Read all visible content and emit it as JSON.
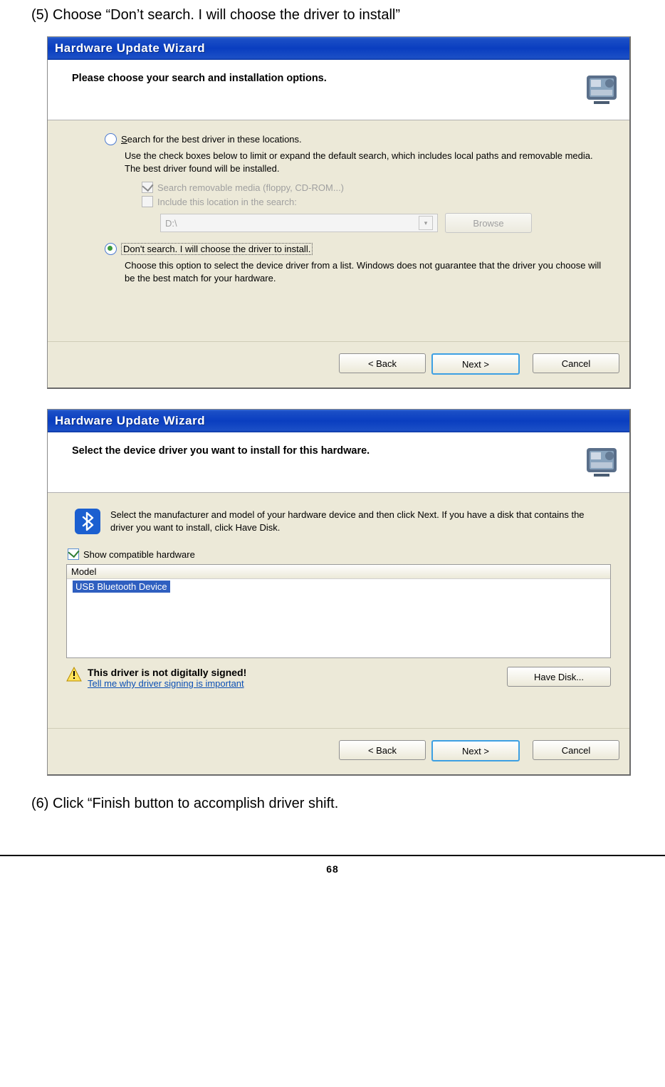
{
  "instruction5": "(5) Choose “Don’t search. I will choose the driver to install”",
  "instruction6": "(6) Click “Finish button to accomplish driver shift.",
  "pageNumber": "68",
  "dialog1": {
    "title": "Hardware Update Wizard",
    "headerTitle": "Please choose your search and installation options.",
    "radio1": {
      "label": "Search for the best driver in these locations.",
      "desc": "Use the check boxes below to limit or expand the default search, which includes local paths and removable media. The best driver found will be installed."
    },
    "chk1": "Search removable media (floppy, CD-ROM...)",
    "chk2": "Include this location in the search:",
    "path": "D:\\",
    "browse": "Browse",
    "radio2": {
      "label": "Don't search. I will choose the driver to install.",
      "desc": "Choose this option to select the device driver from a list.  Windows does not guarantee that the driver you choose will be the best match for your hardware."
    },
    "back": "< Back",
    "next": "Next >",
    "cancel": "Cancel"
  },
  "dialog2": {
    "title": "Hardware Update Wizard",
    "headerTitle": "Select the device driver you want to install for this hardware.",
    "intro": "Select the manufacturer and model of your hardware device and then click Next. If you have a disk that contains the driver you want to install, click Have Disk.",
    "showCompatible": "Show compatible hardware",
    "modelHeader": "Model",
    "modelItem": "USB Bluetooth Device",
    "signTitle": "This driver is not digitally signed!",
    "signLink": "Tell me why driver signing is important",
    "haveDisk": "Have Disk...",
    "back": "< Back",
    "next": "Next >",
    "cancel": "Cancel"
  }
}
